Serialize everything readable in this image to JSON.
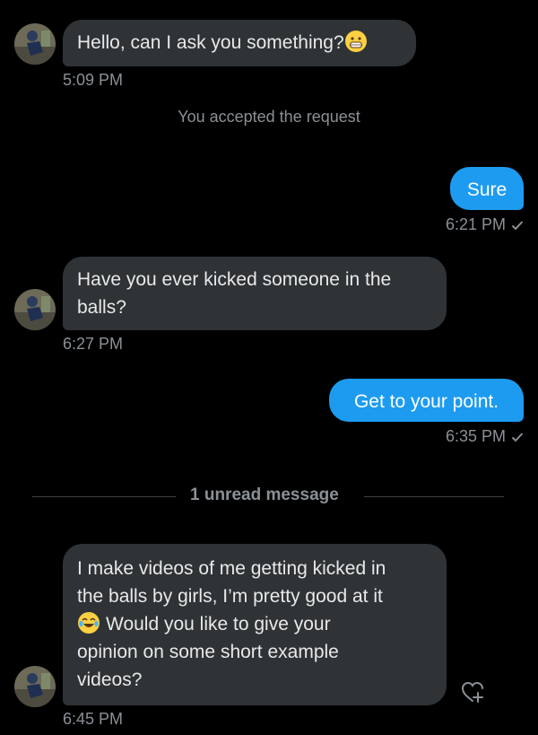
{
  "messages": [
    {
      "text": "Hello, can I ask you something?",
      "time": "5:09 PM"
    },
    {
      "system": "You accepted the request"
    },
    {
      "text": "Sure",
      "time": "6:21 PM"
    },
    {
      "line1": "Have you ever kicked someone in the",
      "line2": "balls?",
      "time": "6:27 PM"
    },
    {
      "text": "Get to your point.",
      "time": "6:35 PM"
    },
    {
      "divider": "1 unread message"
    },
    {
      "line1": "I make videos of me getting kicked in",
      "line2": "the balls by girls, I’m pretty good at it",
      "line3": "Would you like to give your",
      "line4": "opinion on some short example",
      "line5": "videos?",
      "time": "6:45 PM"
    }
  ],
  "icons": {
    "grin_emoji": "grinning-face-emoji",
    "laugh_emoji": "tears-of-joy-emoji",
    "read_check": "checkmark-icon",
    "react": "heart-plus-icon"
  },
  "colors": {
    "incoming_bubble": "#2f3336",
    "outgoing_bubble": "#1d9bf0",
    "timestamp": "#8b9096"
  }
}
